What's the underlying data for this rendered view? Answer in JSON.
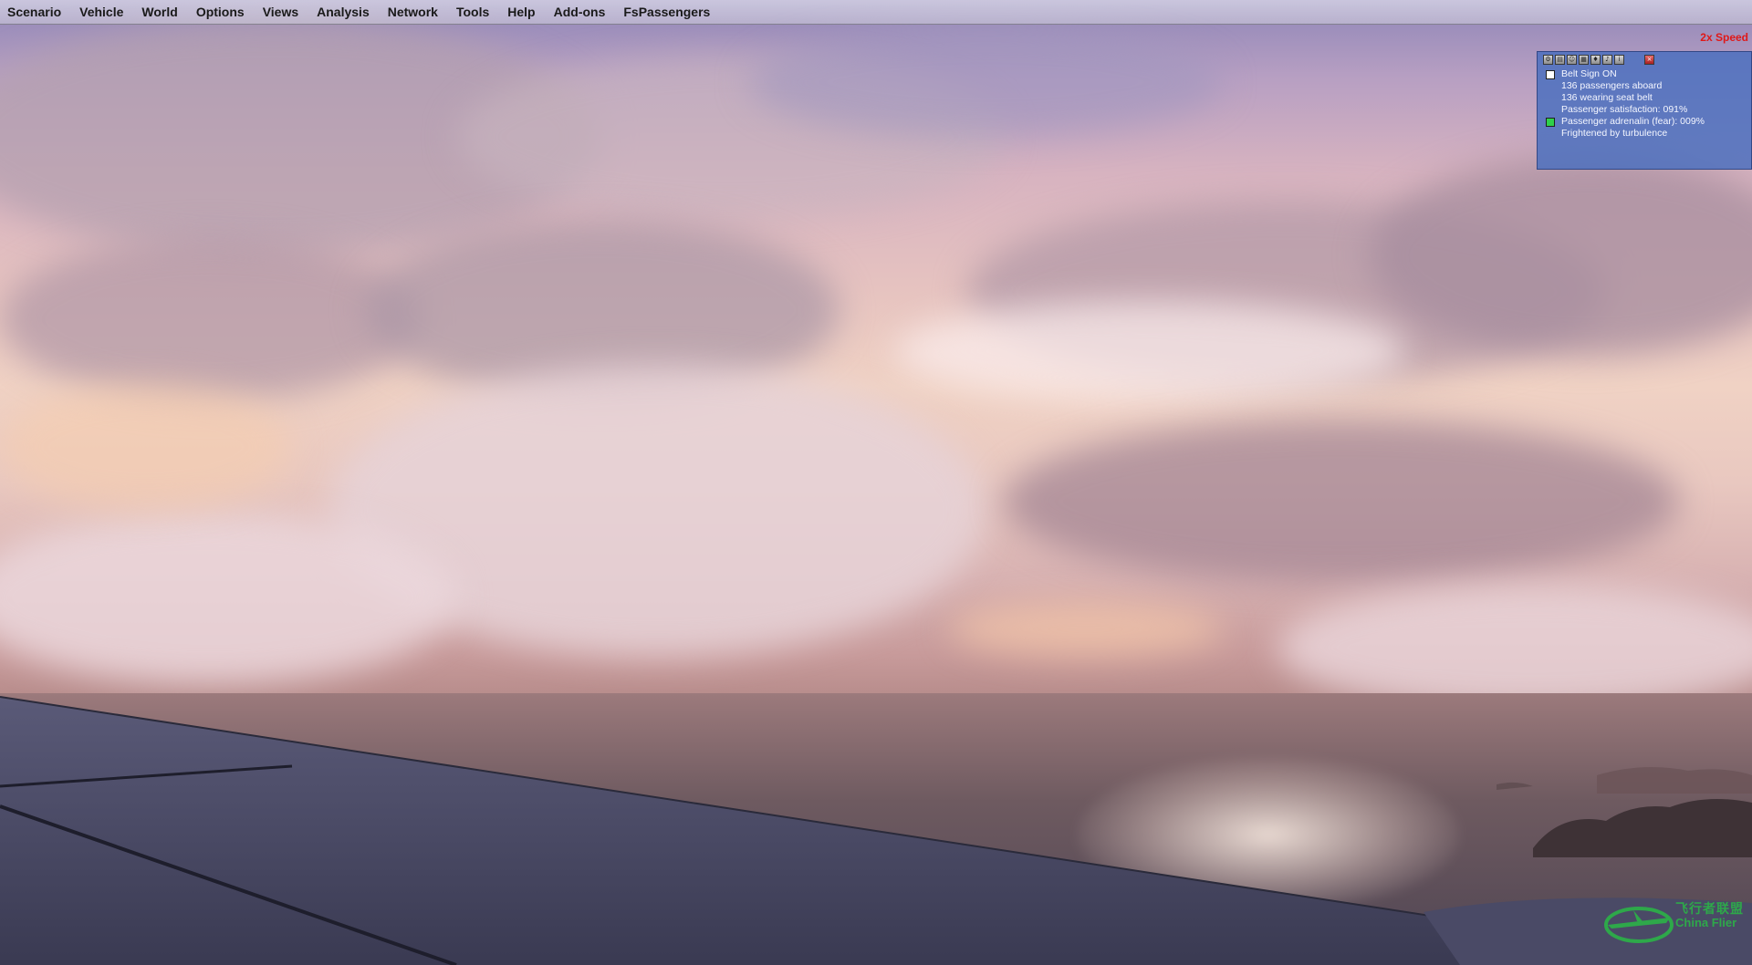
{
  "menubar": {
    "items": [
      {
        "label": "Scenario"
      },
      {
        "label": "Vehicle"
      },
      {
        "label": "World"
      },
      {
        "label": "Options"
      },
      {
        "label": "Views"
      },
      {
        "label": "Analysis"
      },
      {
        "label": "Network"
      },
      {
        "label": "Tools"
      },
      {
        "label": "Help"
      },
      {
        "label": "Add-ons"
      },
      {
        "label": "FsPassengers"
      }
    ]
  },
  "speed_indicator": "2x Speed",
  "fsp_panel": {
    "toolbar_icons": [
      "settings-icon",
      "flight-info-icon",
      "passenger-icon",
      "cabin-icon",
      "crew-icon",
      "announce-icon",
      "info-icon",
      "close-icon"
    ],
    "lines": [
      "Belt Sign ON",
      "136 passengers aboard",
      "136 wearing seat belt",
      "Passenger satisfaction: 091%",
      "Passenger adrenalin (fear): 009%",
      "Frightened by turbulence"
    ],
    "indicator_colors": {
      "belt_sign": "#ffffff",
      "adrenalin": "#2fd04a"
    }
  },
  "watermark": {
    "cn": "飞行者联盟",
    "en": "China Flier",
    "color": "#2ea84a"
  }
}
